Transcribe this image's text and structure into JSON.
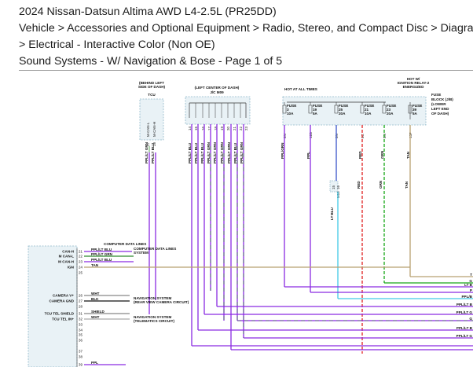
{
  "header": {
    "line1": "2024 Nissan-Datsun Altima AWD L4-2.5L (PR25DD)",
    "line2": "Vehicle > Accessories and Optional Equipment > Radio, Stereo, and Compact Disc > Diagram",
    "line3": "> Electrical - Interactive Color (Non OE)",
    "line4": "Sound Systems - W/ Navigation & Bose - Page 1 of 5"
  },
  "diagram": {
    "tcu": {
      "location": [
        "(BEHIND LEFT",
        "SIDE OF DASH)"
      ],
      "name": "TCU",
      "pins": [
        {
          "pin": "27",
          "color": "PPL/LT GRN",
          "signal": "M-CAN-L"
        },
        {
          "pin": "28",
          "color": "PPL/LT BLU",
          "signal": "M-CAN-H"
        }
      ]
    },
    "jc": {
      "location": "(LEFT CENTER OF DASH)",
      "name": "J/C M09",
      "pins": [
        "14",
        "15",
        "16",
        "17",
        "18",
        "19",
        "20",
        "21",
        "22",
        "23",
        "24",
        "25"
      ],
      "wires": [
        "PPL/LT BLU",
        "PPL/LT BLU",
        "PPL/LT BLU",
        "PPL/LT GRN",
        "PPL/LT GRN",
        "PPL/LT GRN",
        "PPL/LT GRN",
        "PPL/LT BLU",
        "PPL/LT GRN",
        "PPL/LT GRN",
        "PPL/LT GRN",
        "PPL/LT GRN"
      ]
    },
    "fuses": {
      "hot_at_all_times": "HOT AT ALL TIMES",
      "hot_with": [
        "HOT W/",
        "IGNITION RELAY-2",
        "ENERGIZED"
      ],
      "items": [
        {
          "name": "FUSE",
          "num": "3",
          "amp": "10A",
          "conn": "8N",
          "wire": "PPL/GRN"
        },
        {
          "name": "FUSE",
          "num": "19",
          "amp": "5A",
          "conn": "12B",
          "wire": "PPL"
        },
        {
          "name": "FUSE",
          "num": "25",
          "amp": "20A",
          "conn": "3N",
          "wire": "LT BLU"
        },
        {
          "name": "FUSE",
          "num": "21",
          "amp": "10A",
          "conn": "8C",
          "wire": "RED"
        },
        {
          "name": "FUSE",
          "num": "23",
          "amp": "20A",
          "conn": "5N",
          "wire": "GRN"
        },
        {
          "name": "FUSE",
          "num": "39",
          "amp": "5A",
          "conn": "13P",
          "wire": "TAN"
        }
      ],
      "block_label": [
        "FUSE",
        "BLOCK (J/B)",
        "(LOWER",
        "LEFT END",
        "OF DASH)"
      ],
      "splice": {
        "pins": [
          "15",
          "16"
        ],
        "name": "M18"
      }
    },
    "radio": {
      "pins": [
        {
          "pin": "21",
          "wire": "PPL/LT BLU",
          "label": "CAN-H"
        },
        {
          "pin": "22",
          "wire": "PPL/LT GRN",
          "label": "M CAN-L"
        },
        {
          "pin": "23",
          "wire": "PPL/LT BLU",
          "label": "M CAN-H"
        },
        {
          "pin": "24",
          "wire": "TAN",
          "label": "IGN"
        },
        {
          "pin": "25",
          "wire": "",
          "label": ""
        },
        {
          "pin": "26",
          "wire": "WHT",
          "label": "CAMERA V+"
        },
        {
          "pin": "27",
          "wire": "BLK",
          "label": "CAMERA GND"
        },
        {
          "pin": "28",
          "wire": "",
          "label": ""
        },
        {
          "pin": "31",
          "wire": "SHIELD",
          "label": "TCU TEL SHIELD"
        },
        {
          "pin": "32",
          "wire": "WHT",
          "label": "TCU TEL IN+"
        },
        {
          "pin": "33",
          "wire": "",
          "label": ""
        },
        {
          "pin": "34",
          "wire": "",
          "label": ""
        },
        {
          "pin": "35",
          "wire": "",
          "label": ""
        },
        {
          "pin": "36",
          "wire": "",
          "label": ""
        },
        {
          "pin": "37",
          "wire": "",
          "label": ""
        },
        {
          "pin": "38",
          "wire": "",
          "label": ""
        },
        {
          "pin": "39",
          "wire": "PPL",
          "label": ""
        }
      ],
      "notes": {
        "cdl": [
          "COMPUTER DATA LINES",
          "SYSTEM"
        ],
        "cam": [
          "NAVIGATION SYSTEM",
          "(REAR VIEW CAMERA CIRCUIT)"
        ],
        "tel": [
          "NAVIGATION SYSTEM",
          "(TELEMATICS CIRCUIT)"
        ]
      }
    },
    "right_edge_labels": [
      "T",
      "G",
      "LT B",
      "P",
      "PPL/B",
      "PPL/LT B",
      "PPL/LT G",
      "G",
      "PPL/LT B",
      "PPL/LT G"
    ],
    "colors": {
      "purple": "#8a2be2",
      "purple_green": "#2e8b2e",
      "tan": "#b8a070",
      "lt_blue": "#41c9e6",
      "red": "#e02020",
      "green": "#17a817",
      "splice_box": "#8fb7c9"
    }
  }
}
